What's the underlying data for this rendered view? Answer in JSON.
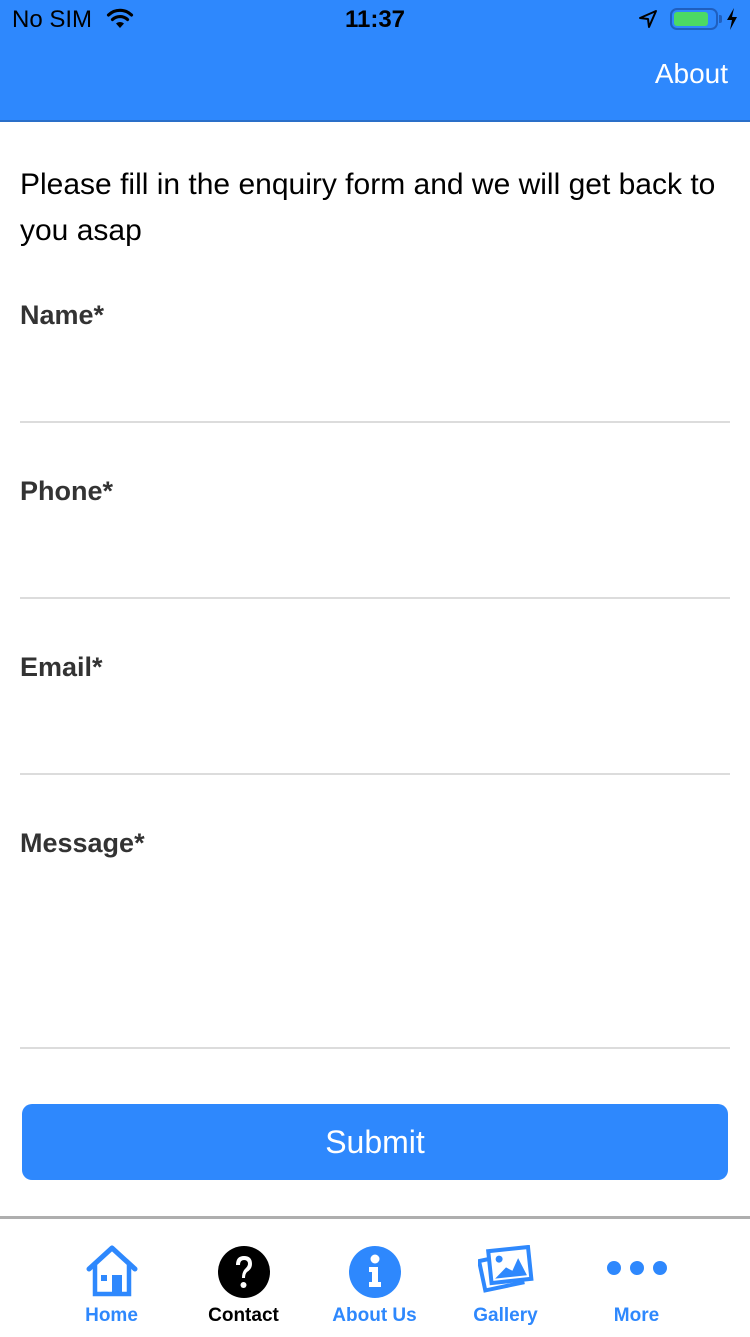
{
  "status_bar": {
    "carrier": "No SIM",
    "time": "11:37",
    "battery_level": 0.85,
    "charging": true
  },
  "header": {
    "action_label": "About"
  },
  "intro_text": "Please fill in the enquiry form and we will get back to you asap",
  "form": {
    "fields": [
      {
        "label": "Name*",
        "value": "",
        "placeholder": ""
      },
      {
        "label": "Phone*",
        "value": "",
        "placeholder": ""
      },
      {
        "label": "Email*",
        "value": "",
        "placeholder": ""
      },
      {
        "label": "Message*",
        "value": "",
        "placeholder": ""
      }
    ],
    "submit_label": "Submit"
  },
  "tabbar": {
    "items": [
      {
        "label": "Home",
        "icon": "home-icon",
        "active": false
      },
      {
        "label": "Contact",
        "icon": "question-circle-icon",
        "active": true
      },
      {
        "label": "About Us",
        "icon": "info-circle-icon",
        "active": false
      },
      {
        "label": "Gallery",
        "icon": "gallery-icon",
        "active": false
      },
      {
        "label": "More",
        "icon": "more-dots-icon",
        "active": false
      }
    ]
  },
  "colors": {
    "primary": "#2e88fd",
    "active_tab": "#000000",
    "divider": "#dcdcdc"
  }
}
